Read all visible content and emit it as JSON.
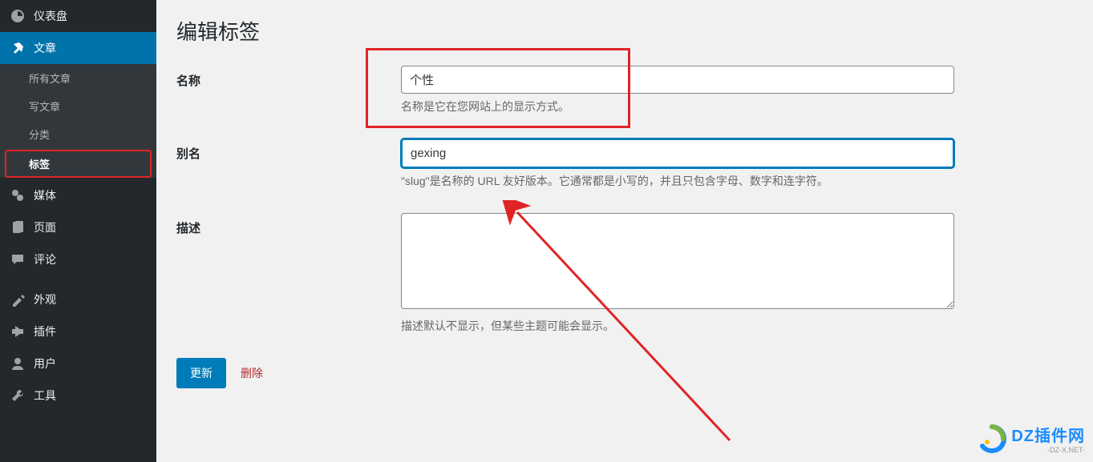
{
  "sidebar": {
    "dashboard": "仪表盘",
    "posts": "文章",
    "all_posts": "所有文章",
    "new_post": "写文章",
    "categories": "分类",
    "tags": "标签",
    "media": "媒体",
    "pages": "页面",
    "comments": "评论",
    "appearance": "外观",
    "plugins": "插件",
    "users": "用户",
    "tools": "工具"
  },
  "page": {
    "title": "编辑标签",
    "name_label": "名称",
    "name_value": "个性",
    "name_help": "名称是它在您网站上的显示方式。",
    "slug_label": "别名",
    "slug_value": "gexing",
    "slug_help": "\"slug\"是名称的 URL 友好版本。它通常都是小写的，并且只包含字母、数字和连字符。",
    "desc_label": "描述",
    "desc_value": "",
    "desc_help": "描述默认不显示，但某些主题可能会显示。",
    "update_btn": "更新",
    "delete_link": "删除"
  },
  "watermark": {
    "text": "DZ插件网",
    "sub": "-DZ-X.NET-"
  }
}
